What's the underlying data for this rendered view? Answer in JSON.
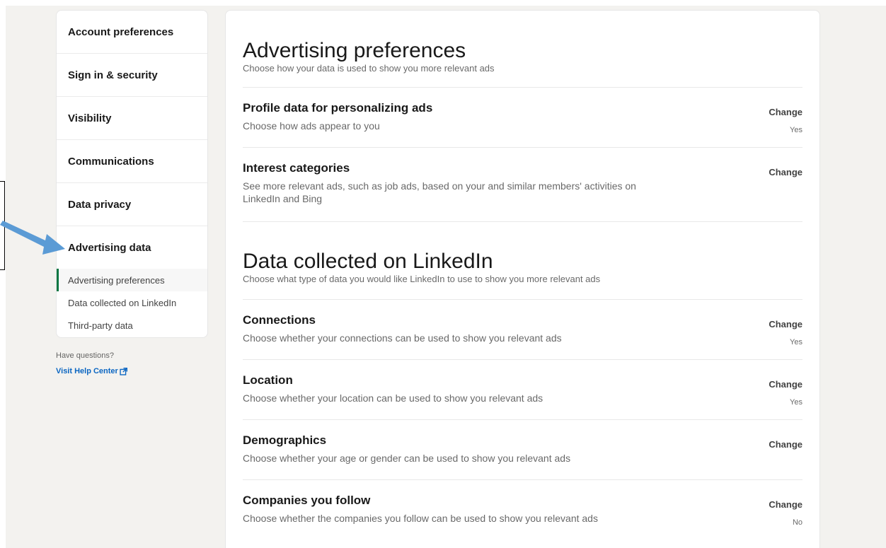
{
  "sidebar": {
    "items": [
      {
        "label": "Account preferences"
      },
      {
        "label": "Sign in & security"
      },
      {
        "label": "Visibility"
      },
      {
        "label": "Communications"
      },
      {
        "label": "Data privacy"
      },
      {
        "label": "Advertising data"
      }
    ],
    "subitems": [
      {
        "label": "Advertising preferences",
        "active": true
      },
      {
        "label": "Data collected on LinkedIn"
      },
      {
        "label": "Third-party data"
      }
    ],
    "help_question": "Have questions?",
    "help_link": "Visit Help Center",
    "help_link_icon": "external-link-icon"
  },
  "sections": [
    {
      "title": "Advertising preferences",
      "subtitle": "Choose how your data is used to show you more relevant ads",
      "rows": [
        {
          "title": "Profile data for personalizing ads",
          "desc": "Choose how ads appear to you",
          "action": "Change",
          "value": "Yes"
        },
        {
          "title": "Interest categories",
          "desc": "See more relevant ads, such as job ads, based on your and similar members' activities on LinkedIn and Bing",
          "action": "Change",
          "value": ""
        }
      ]
    },
    {
      "title": "Data collected on LinkedIn",
      "subtitle": "Choose what type of data you would like LinkedIn to use to show you more relevant ads",
      "rows": [
        {
          "title": "Connections",
          "desc": "Choose whether your connections can be used to show you relevant ads",
          "action": "Change",
          "value": "Yes"
        },
        {
          "title": "Location",
          "desc": "Choose whether your location can be used to show you relevant ads",
          "action": "Change",
          "value": "Yes"
        },
        {
          "title": "Demographics",
          "desc": "Choose whether your age or gender can be used to show you relevant ads",
          "action": "Change",
          "value": ""
        },
        {
          "title": "Companies you follow",
          "desc": "Choose whether the companies you follow can be used to show you relevant ads",
          "action": "Change",
          "value": "No"
        }
      ]
    }
  ],
  "colors": {
    "page_bg": "#f3f2ef",
    "active_indicator": "#057642",
    "link": "#0a66c2",
    "annotation_arrow": "#5b9bd5"
  }
}
